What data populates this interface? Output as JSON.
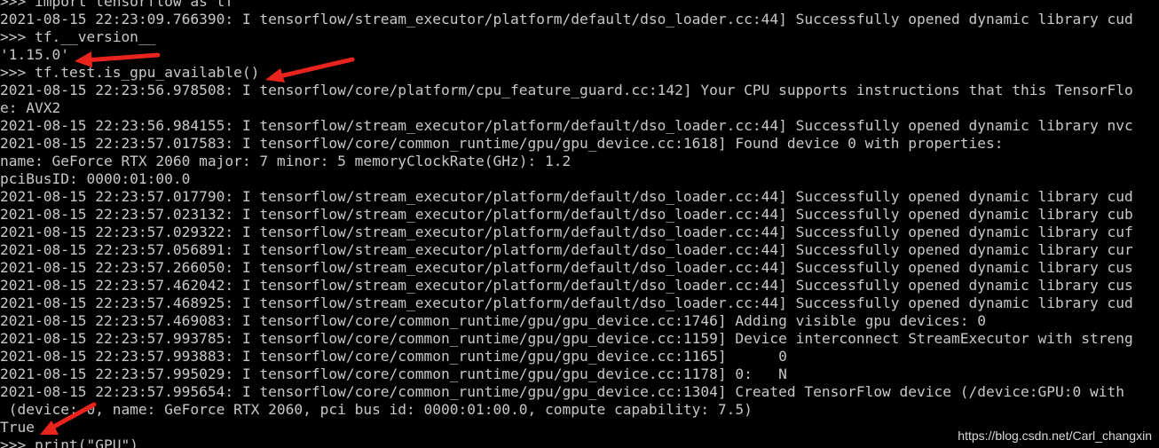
{
  "console": {
    "lines": [
      ">>> import tensorflow as tf",
      "2021-08-15 22:23:09.766390: I tensorflow/stream_executor/platform/default/dso_loader.cc:44] Successfully opened dynamic library cud",
      ">>> tf.__version__",
      "'1.15.0'",
      ">>> tf.test.is_gpu_available()",
      "2021-08-15 22:23:56.978508: I tensorflow/core/platform/cpu_feature_guard.cc:142] Your CPU supports instructions that this TensorFlo",
      "e: AVX2",
      "2021-08-15 22:23:56.984155: I tensorflow/stream_executor/platform/default/dso_loader.cc:44] Successfully opened dynamic library nvc",
      "2021-08-15 22:23:57.017583: I tensorflow/core/common_runtime/gpu/gpu_device.cc:1618] Found device 0 with properties:",
      "name: GeForce RTX 2060 major: 7 minor: 5 memoryClockRate(GHz): 1.2",
      "pciBusID: 0000:01:00.0",
      "2021-08-15 22:23:57.017790: I tensorflow/stream_executor/platform/default/dso_loader.cc:44] Successfully opened dynamic library cud",
      "2021-08-15 22:23:57.023132: I tensorflow/stream_executor/platform/default/dso_loader.cc:44] Successfully opened dynamic library cub",
      "2021-08-15 22:23:57.029322: I tensorflow/stream_executor/platform/default/dso_loader.cc:44] Successfully opened dynamic library cuf",
      "2021-08-15 22:23:57.056891: I tensorflow/stream_executor/platform/default/dso_loader.cc:44] Successfully opened dynamic library cur",
      "2021-08-15 22:23:57.266050: I tensorflow/stream_executor/platform/default/dso_loader.cc:44] Successfully opened dynamic library cus",
      "2021-08-15 22:23:57.462042: I tensorflow/stream_executor/platform/default/dso_loader.cc:44] Successfully opened dynamic library cus",
      "2021-08-15 22:23:57.468925: I tensorflow/stream_executor/platform/default/dso_loader.cc:44] Successfully opened dynamic library cud",
      "2021-08-15 22:23:57.469083: I tensorflow/core/common_runtime/gpu/gpu_device.cc:1746] Adding visible gpu devices: 0",
      "2021-08-15 22:23:57.993785: I tensorflow/core/common_runtime/gpu/gpu_device.cc:1159] Device interconnect StreamExecutor with streng",
      "2021-08-15 22:23:57.993883: I tensorflow/core/common_runtime/gpu/gpu_device.cc:1165]      0",
      "2021-08-15 22:23:57.995029: I tensorflow/core/common_runtime/gpu/gpu_device.cc:1178] 0:   N",
      "2021-08-15 22:23:57.995654: I tensorflow/core/common_runtime/gpu/gpu_device.cc:1304] Created TensorFlow device (/device:GPU:0 with",
      " (device: 0, name: GeForce RTX 2060, pci bus id: 0000:01:00.0, compute capability: 7.5)",
      "True",
      ">>> print(\"GPU\")"
    ]
  },
  "watermark": "https://blog.csdn.net/Carl_changxin",
  "colors": {
    "background": "#000000",
    "text": "#c8c8c8",
    "arrow": "#e8241c"
  }
}
